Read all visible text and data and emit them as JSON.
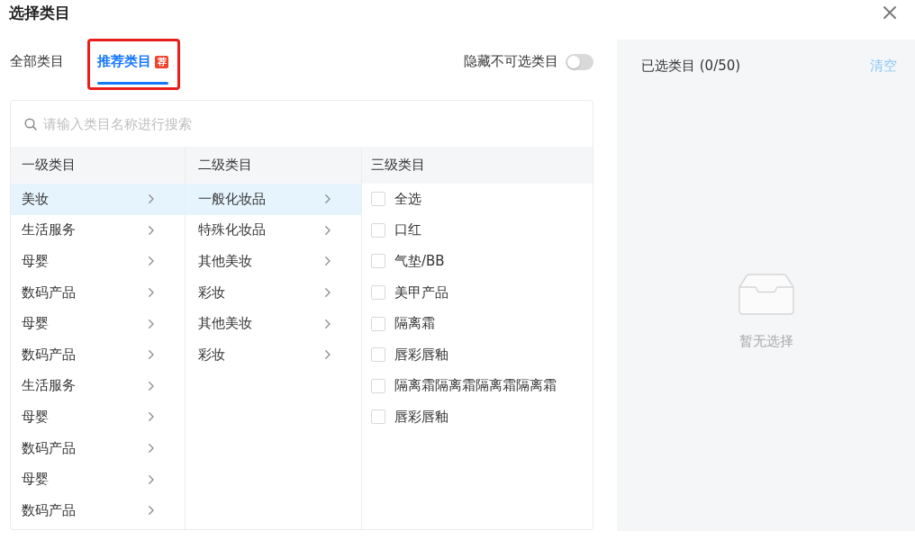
{
  "dialog": {
    "title": "选择类目"
  },
  "tabs": [
    {
      "label": "全部类目",
      "selected": false,
      "highlighted": false
    },
    {
      "label": "推荐类目",
      "selected": true,
      "highlighted": true,
      "badge": "荐"
    }
  ],
  "hide_unavailable_toggle": {
    "label": "隐藏不可选类目",
    "on": false
  },
  "search": {
    "placeholder": "请输入类目名称进行搜索"
  },
  "columns": [
    {
      "kind": "nav",
      "heading": "一级类目",
      "items": [
        {
          "label": "美妆",
          "selected": true
        },
        {
          "label": "生活服务",
          "selected": false
        },
        {
          "label": "母婴",
          "selected": false
        },
        {
          "label": "数码产品",
          "selected": false
        },
        {
          "label": "母婴",
          "selected": false
        },
        {
          "label": "数码产品",
          "selected": false
        },
        {
          "label": "生活服务",
          "selected": false
        },
        {
          "label": "母婴",
          "selected": false
        },
        {
          "label": "数码产品",
          "selected": false
        },
        {
          "label": "母婴",
          "selected": false
        },
        {
          "label": "数码产品",
          "selected": false
        }
      ]
    },
    {
      "kind": "nav",
      "heading": "二级类目",
      "items": [
        {
          "label": "一般化妆品",
          "selected": true
        },
        {
          "label": "特殊化妆品",
          "selected": false
        },
        {
          "label": "其他美妆",
          "selected": false
        },
        {
          "label": "彩妆",
          "selected": false
        },
        {
          "label": "其他美妆",
          "selected": false
        },
        {
          "label": "彩妆",
          "selected": false
        }
      ]
    },
    {
      "kind": "check",
      "heading": "三级类目",
      "items": [
        {
          "label": "全选",
          "checked": false
        },
        {
          "label": "口红",
          "checked": false
        },
        {
          "label": "气垫/BB",
          "checked": false
        },
        {
          "label": "美甲产品",
          "checked": false
        },
        {
          "label": "隔离霜",
          "checked": false
        },
        {
          "label": "唇彩唇釉",
          "checked": false
        },
        {
          "label": "隔离霜隔离霜隔离霜隔离霜",
          "checked": false
        },
        {
          "label": "唇彩唇釉",
          "checked": false
        }
      ]
    }
  ],
  "selected_panel": {
    "title": "已选类目 (0/50)",
    "clear_link": "清空",
    "empty_text": "暂无选择"
  }
}
